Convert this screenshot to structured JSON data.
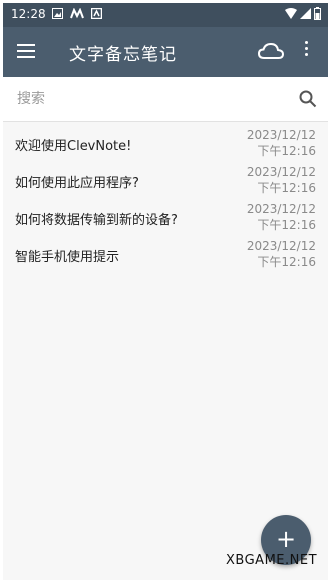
{
  "status_bar": {
    "time": "12:28"
  },
  "app_bar": {
    "title": "文字备忘笔记"
  },
  "search": {
    "placeholder": "搜索"
  },
  "notes": [
    {
      "title": "欢迎使用ClevNote!",
      "date": "2023/12/12",
      "time": "下午12:16"
    },
    {
      "title": "如何使用此应用程序?",
      "date": "2023/12/12",
      "time": "下午12:16"
    },
    {
      "title": "如何将数据传输到新的设备?",
      "date": "2023/12/12",
      "time": "下午12:16"
    },
    {
      "title": "智能手机使用提示",
      "date": "2023/12/12",
      "time": "下午12:16"
    }
  ],
  "fab": {
    "label": "+"
  },
  "watermark": {
    "text": "XBGAME.NET"
  },
  "colors": {
    "app_bar": "#4b5d6e",
    "status_bar": "#3f4f5e",
    "background": "#f7f7f7"
  }
}
